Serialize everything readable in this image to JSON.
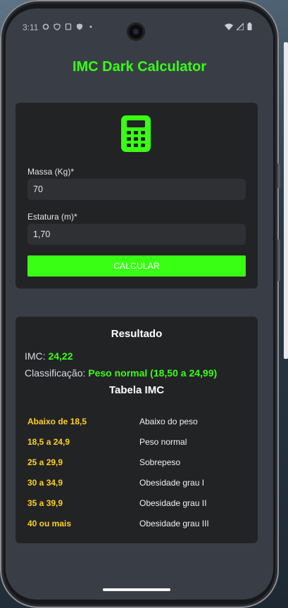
{
  "status_bar": {
    "time": "3:11",
    "left_icons": [
      "settings-icon",
      "shield-icon",
      "storage-icon",
      "vpn-shield-icon",
      "dot-icon"
    ],
    "right_icons": [
      "wifi-icon",
      "signal-icon",
      "battery-icon"
    ]
  },
  "app": {
    "title": "IMC Dark Calculator",
    "accent_color": "#39ff14"
  },
  "form": {
    "icon": "calculator-icon",
    "mass_label": "Massa (Kg)*",
    "mass_value": "70",
    "height_label": "Estatura (m)*",
    "height_value": "1,70",
    "button_label": "CALCULAR"
  },
  "result": {
    "title": "Resultado",
    "imc_label": "IMC:",
    "imc_value": "24,22",
    "class_label": "Classificação:",
    "class_value": "Peso normal (18,50 a 24,99)"
  },
  "table": {
    "title": "Tabela IMC",
    "rows": [
      {
        "range": "Abaixo de 18,5",
        "classification": "Abaixo do peso"
      },
      {
        "range": "18,5 a 24,9",
        "classification": "Peso normal"
      },
      {
        "range": "25 a 29,9",
        "classification": "Sobrepeso"
      },
      {
        "range": "30 a 34,9",
        "classification": "Obesidade grau I"
      },
      {
        "range": "35 a 39,9",
        "classification": "Obesidade grau II"
      },
      {
        "range": "40 ou mais",
        "classification": "Obesidade grau III"
      }
    ]
  }
}
